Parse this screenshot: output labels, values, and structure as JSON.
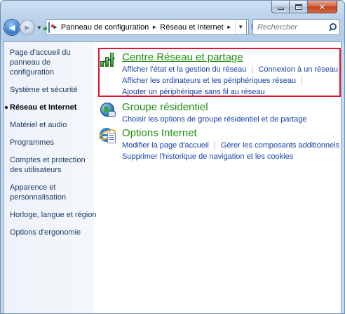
{
  "window": {
    "caption_buttons": [
      "minimize-icon",
      "maximize-icon",
      "close-icon"
    ],
    "close_glyph": "✕"
  },
  "nav": {
    "back_glyph": "◄",
    "forward_glyph": "►",
    "history_glyph": "▼",
    "breadcrumb_sep": "►",
    "breadcrumbs": [
      "Panneau de configuration",
      "Réseau et Internet"
    ],
    "refresh_glyph": "↻",
    "dropdown_glyph": "▼"
  },
  "search": {
    "placeholder": "Rechercher"
  },
  "sidebar": {
    "items": [
      {
        "label": "Page d'accueil du panneau de configuration",
        "current": false
      },
      {
        "label": "Système et sécurité",
        "current": false
      },
      {
        "label": "Réseau et Internet",
        "current": true
      },
      {
        "label": "Matériel et audio",
        "current": false
      },
      {
        "label": "Programmes",
        "current": false
      },
      {
        "label": "Comptes et protection des utilisateurs",
        "current": false
      },
      {
        "label": "Apparence et personnalisation",
        "current": false
      },
      {
        "label": "Horloge, langue et région",
        "current": false
      },
      {
        "label": "Options d'ergonomie",
        "current": false
      }
    ]
  },
  "categories": [
    {
      "title": "Centre Réseau et partage",
      "icon": "network-center-icon",
      "highlighted": true,
      "tasks": [
        "Afficher l'état et la gestion du réseau",
        "Connexion à un réseau",
        "Afficher les ordinateurs et les périphériques réseau",
        "Ajouter un périphérique sans fil au réseau"
      ]
    },
    {
      "title": "Groupe résidentiel",
      "icon": "homegroup-icon",
      "highlighted": false,
      "tasks": [
        "Choisir les options de groupe résidentiel et de partage"
      ]
    },
    {
      "title": "Options Internet",
      "icon": "internet-options-icon",
      "highlighted": false,
      "tasks": [
        "Modifier la page d'accueil",
        "Gérer les composants additionnels",
        "Supprimer l'historique de navigation et les cookies"
      ]
    }
  ],
  "colors": {
    "category_title": "#1e8f12",
    "task_link": "#1840a8",
    "highlight_border": "#e0142a",
    "sidebar_link": "#1c3a68"
  }
}
